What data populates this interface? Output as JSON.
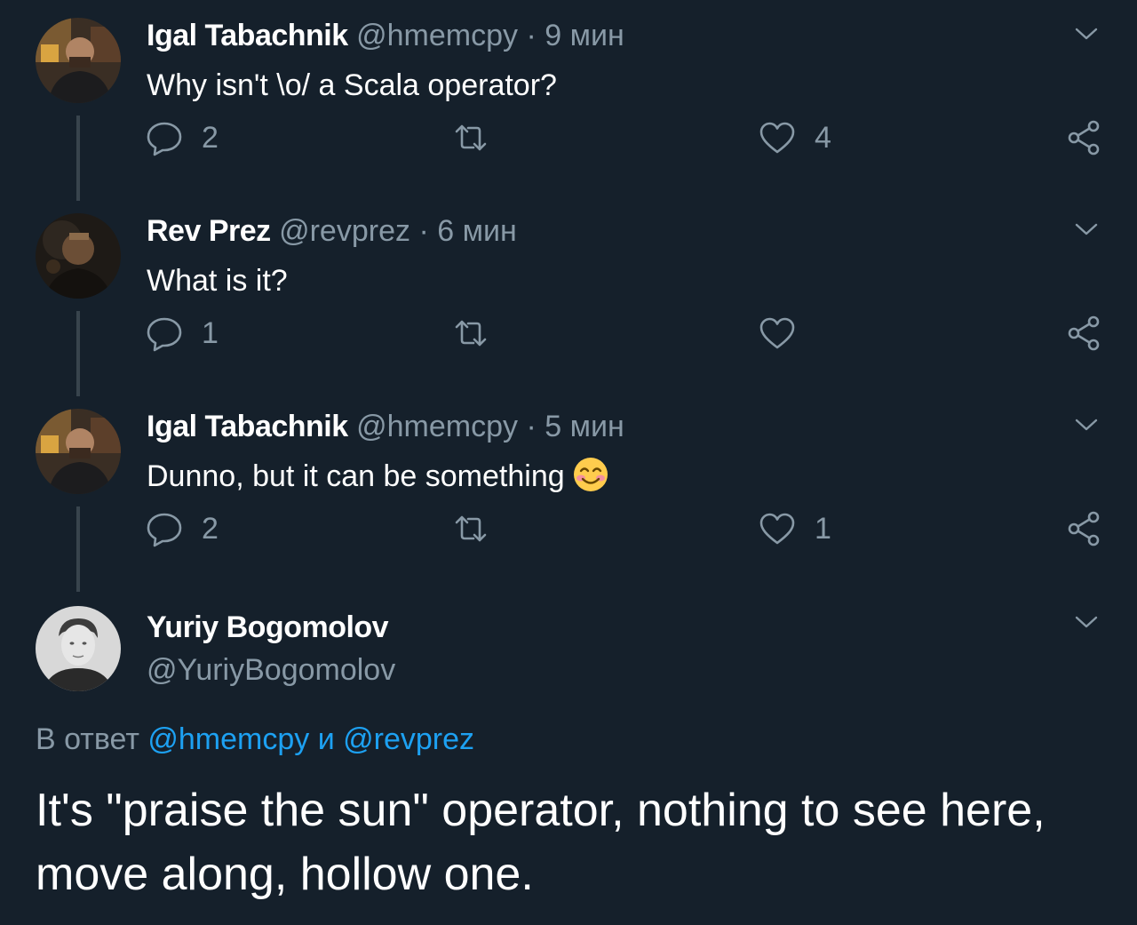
{
  "tweets": [
    {
      "name": "Igal Tabachnik",
      "handle": "@hmemcpy",
      "dot": "·",
      "time": "9 мин",
      "text": "Why isn't \\o/ a Scala operator?",
      "reply_count": "2",
      "retweet_count": "",
      "like_count": "4"
    },
    {
      "name": "Rev Prez",
      "handle": "@revprez",
      "dot": "·",
      "time": "6 мин",
      "text": "What is it?",
      "reply_count": "1",
      "retweet_count": "",
      "like_count": ""
    },
    {
      "name": "Igal Tabachnik",
      "handle": "@hmemcpy",
      "dot": "·",
      "time": "5 мин",
      "text": "Dunno, but it can be something",
      "emoji": "smiling-face-icon",
      "reply_count": "2",
      "retweet_count": "",
      "like_count": "1"
    }
  ],
  "main": {
    "name": "Yuriy Bogomolov",
    "handle": "@YuriyBogomolov",
    "reply_prefix": "В ответ",
    "mention1": "@hmemcpy",
    "conj": "и",
    "mention2": "@revprez",
    "body": "It's \"praise the sun\" operator, nothing to see here, move along, hollow one."
  },
  "icons": {
    "reply": "reply-icon",
    "retweet": "retweet-icon",
    "like": "heart-icon",
    "share": "share-icon",
    "menu": "chevron-down-icon"
  },
  "colors": {
    "background": "#15202b",
    "text": "#ffffff",
    "secondary": "#8899a6",
    "link": "#1da1f2",
    "thread_line": "#38444d"
  }
}
